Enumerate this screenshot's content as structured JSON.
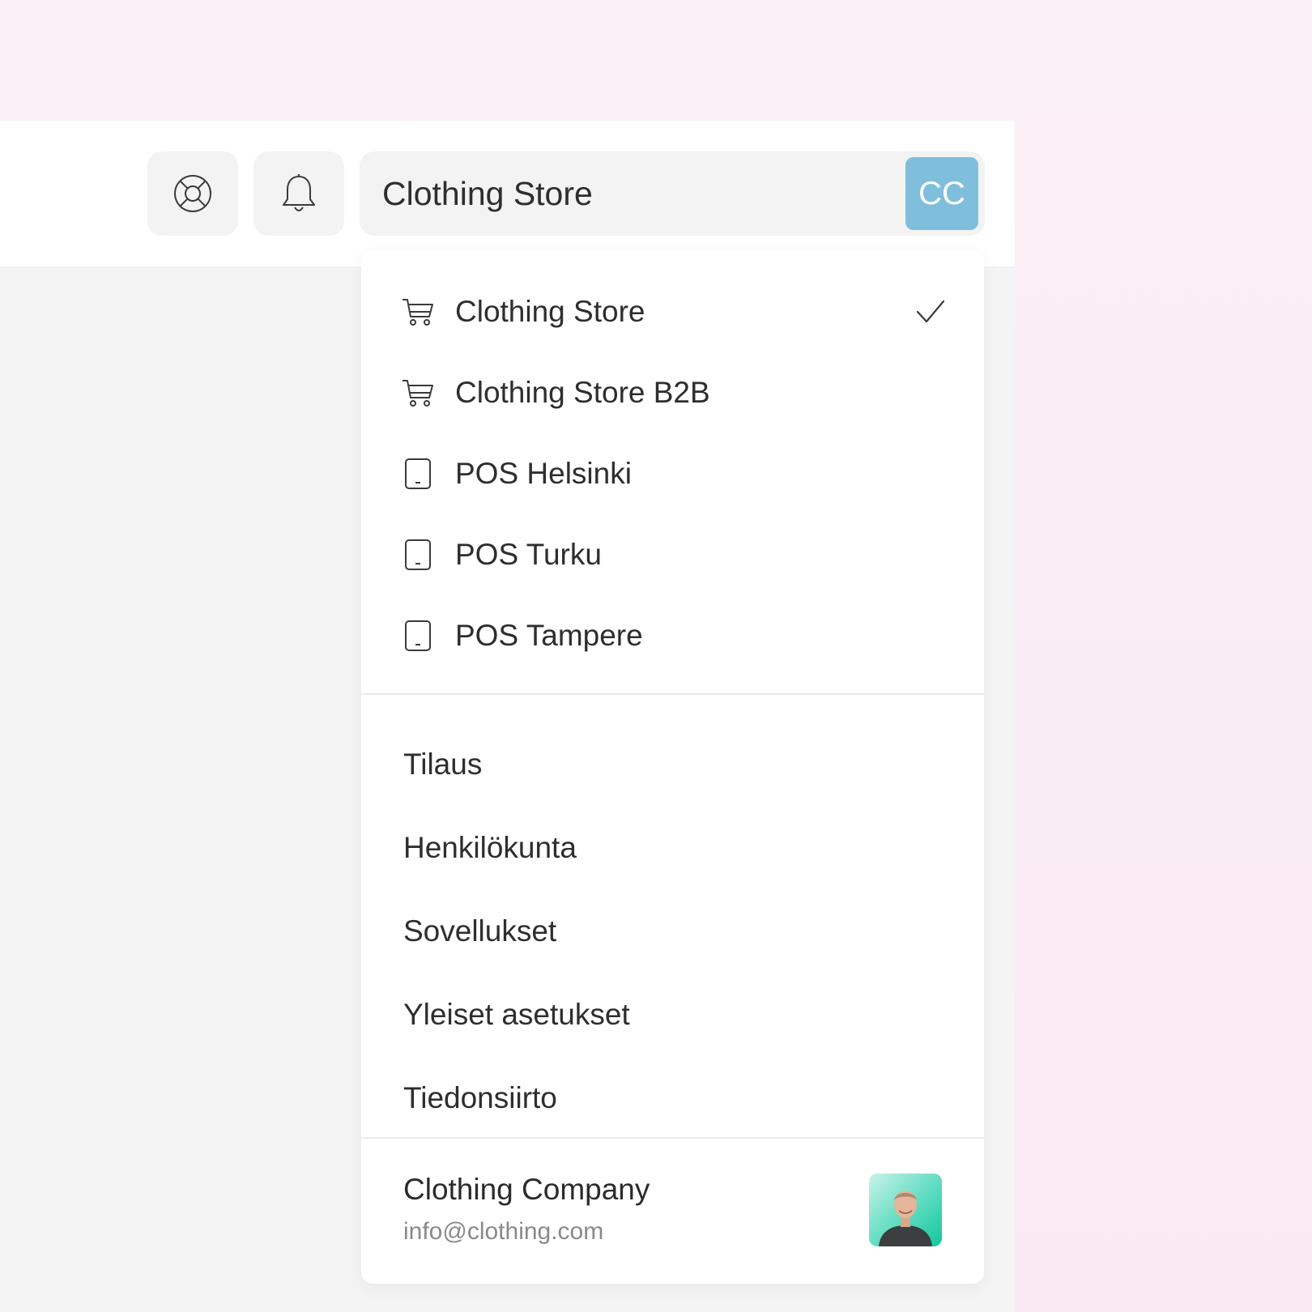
{
  "header": {
    "help_icon": "lifebuoy-icon",
    "notifications_icon": "bell-icon",
    "store_selector": {
      "selected_label": "Clothing Store",
      "badge": "CC",
      "badge_color": "#7fbfdc"
    }
  },
  "dropdown": {
    "stores": [
      {
        "label": "Clothing Store",
        "icon": "shopping-cart-icon",
        "selected": true
      },
      {
        "label": "Clothing Store B2B",
        "icon": "shopping-cart-icon",
        "selected": false
      },
      {
        "label": "POS Helsinki",
        "icon": "tablet-icon",
        "selected": false
      },
      {
        "label": "POS Turku",
        "icon": "tablet-icon",
        "selected": false
      },
      {
        "label": "POS Tampere",
        "icon": "tablet-icon",
        "selected": false
      }
    ],
    "menu": [
      {
        "label": "Tilaus"
      },
      {
        "label": "Henkilökunta"
      },
      {
        "label": "Sovellukset"
      },
      {
        "label": "Yleiset asetukset"
      },
      {
        "label": "Tiedonsiirto"
      }
    ],
    "account": {
      "company": "Clothing Company",
      "email": "info@clothing.com",
      "avatar_icon": "user-avatar-icon"
    }
  }
}
